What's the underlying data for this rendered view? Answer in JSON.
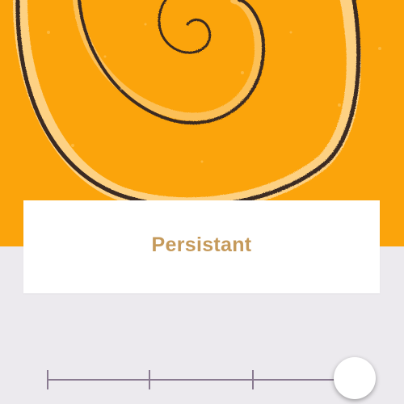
{
  "hero": {
    "icon": "spiral-illustration",
    "background_color": "#fba40b",
    "stroke_color": "#3a2a22"
  },
  "card": {
    "title": "Persistant",
    "title_color": "#c59a5b"
  },
  "slider": {
    "steps": 4,
    "selected_step": 4,
    "value_fraction": 1.0,
    "track_color": "#8a7b91"
  }
}
